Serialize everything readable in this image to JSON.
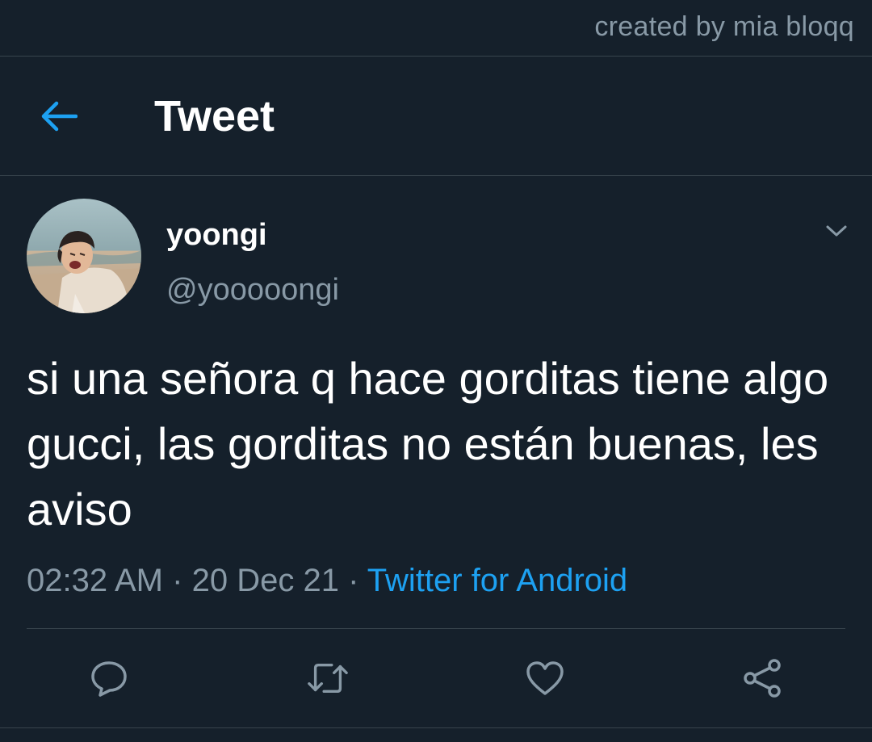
{
  "watermark": "created by mia bloqq",
  "header": {
    "title": "Tweet",
    "back_icon": "arrow-left-icon"
  },
  "colors": {
    "background": "#15202b",
    "accent": "#1da1f2",
    "secondary_text": "#8899a6",
    "divider": "#38444d"
  },
  "tweet": {
    "author": {
      "name": "yoongi",
      "handle": "@yooooongi"
    },
    "text": "si una señora q hace gorditas tiene algo gucci, las gorditas no están buenas, les aviso",
    "time": "02:32 AM",
    "separator": "·",
    "date": "20 Dec 21",
    "source": "Twitter for Android"
  },
  "actions": [
    {
      "icon": "reply-icon"
    },
    {
      "icon": "retweet-icon"
    },
    {
      "icon": "like-icon"
    },
    {
      "icon": "share-icon"
    }
  ]
}
